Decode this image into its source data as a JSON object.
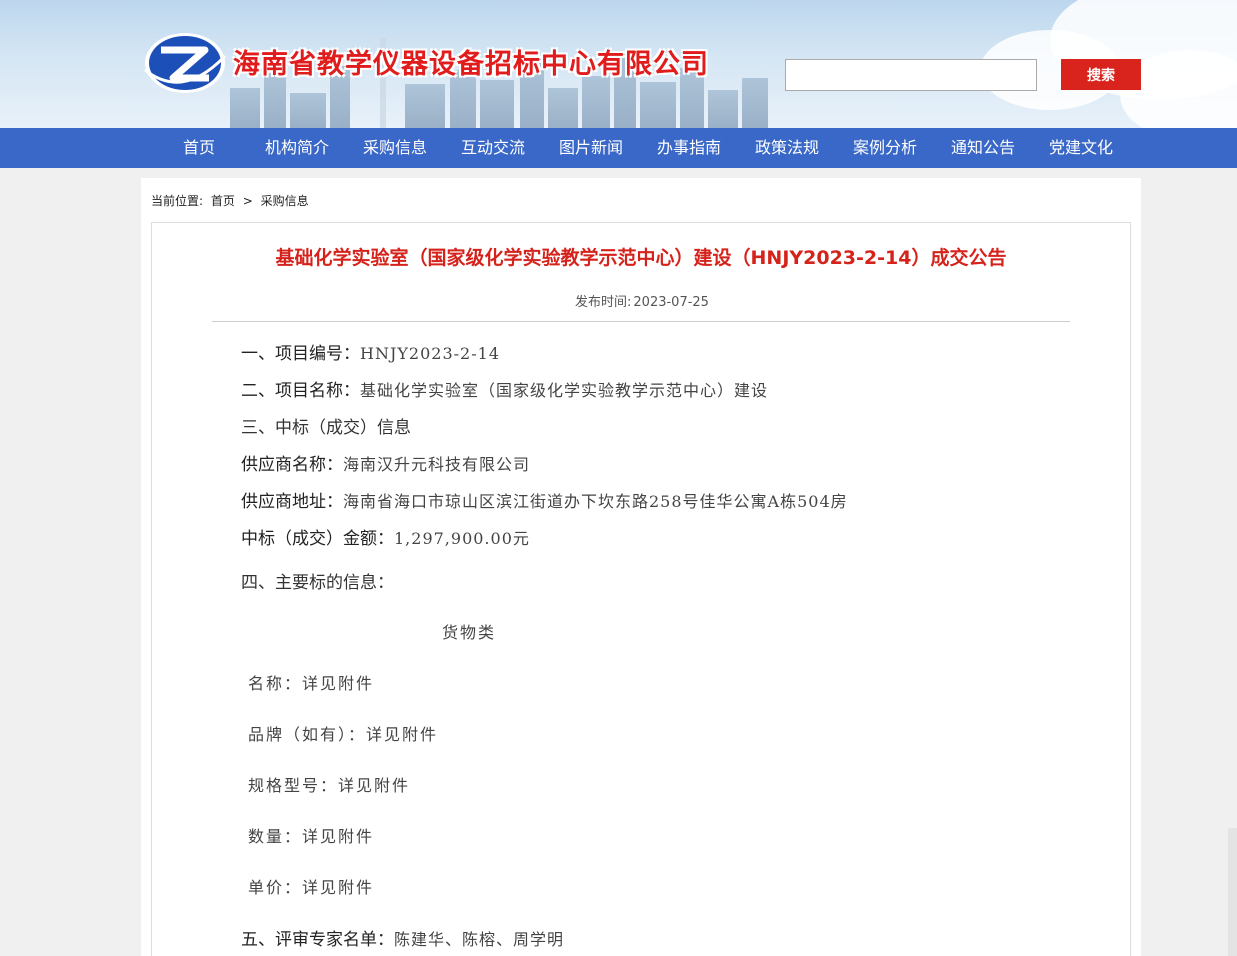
{
  "header": {
    "site_title": "海南省教学仪器设备招标中心有限公司",
    "search_placeholder": "",
    "search_button": "搜索"
  },
  "nav": {
    "items": [
      "首页",
      "机构简介",
      "采购信息",
      "互动交流",
      "图片新闻",
      "办事指南",
      "政策法规",
      "案例分析",
      "通知公告",
      "党建文化"
    ]
  },
  "breadcrumb": {
    "label": "当前位置:",
    "home": "首页",
    "separator": ">",
    "current": "采购信息"
  },
  "article": {
    "title": "基础化学实验室（国家级化学实验教学示范中心）建设（HNJY2023-2-14）成交公告",
    "date_label": "发布时间:",
    "date": "2023-07-25",
    "project_no_label": "一、项目编号：",
    "project_no": "HNJY2023-2-14",
    "project_name_label": "二、项目名称：",
    "project_name": "基础化学实验室（国家级化学实验教学示范中心）建设",
    "section3": "三、中标（成交）信息",
    "supplier_name_label": "供应商名称：",
    "supplier_name": "海南汉升元科技有限公司",
    "supplier_addr_label": "供应商地址：",
    "supplier_addr": "海南省海口市琼山区滨江街道办下坎东路258号佳华公寓A栋504房",
    "amount_label": "中标（成交）金额：",
    "amount": "1,297,900.00元",
    "section4": "四、主要标的信息：",
    "goods_type": "货物类",
    "goods_name": "名称：详见附件",
    "goods_brand": "品牌（如有）：详见附件",
    "goods_spec": "规格型号：详见附件",
    "goods_qty": "数量：详见附件",
    "goods_price": "单价：详见附件",
    "experts_label": "五、评审专家名单：",
    "experts": "陈建华、陈榕、周学明"
  },
  "colors": {
    "nav_bg": "#3a68c8",
    "title_red": "#d5231c",
    "search_btn": "#d9231d"
  }
}
